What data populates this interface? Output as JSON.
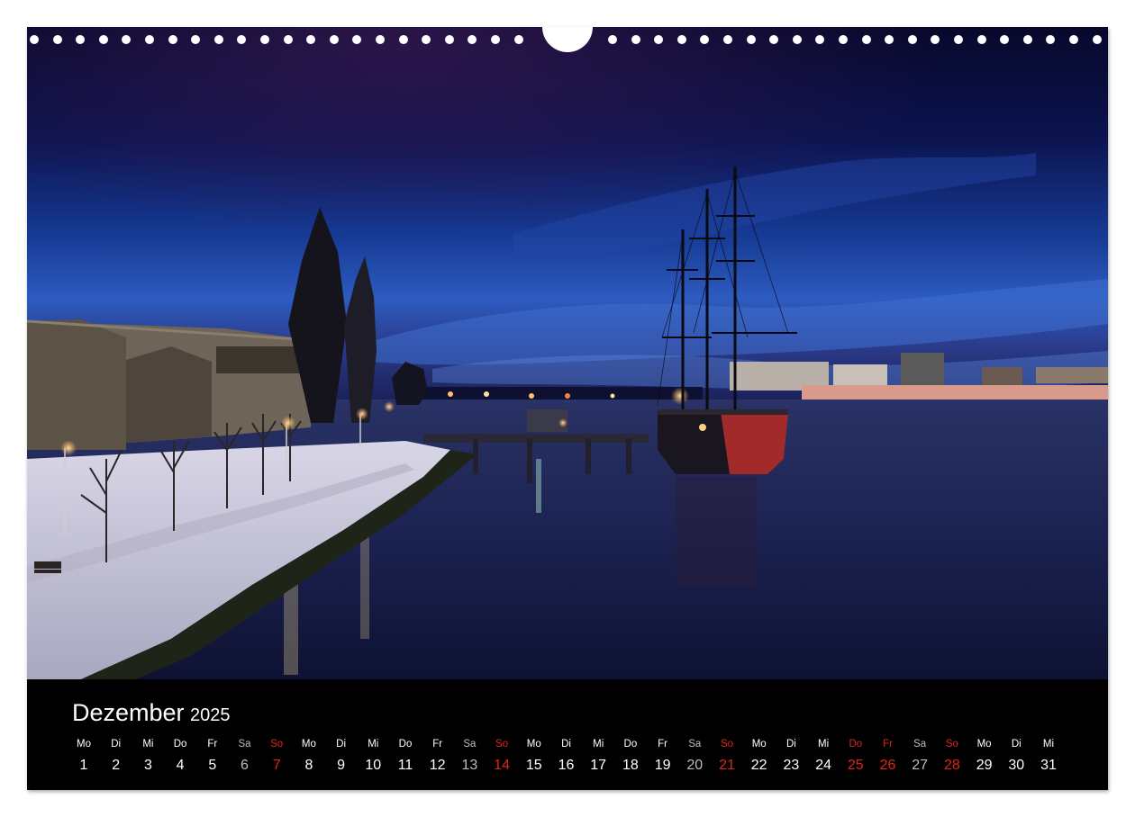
{
  "calendar": {
    "month": "Dezember",
    "year": "2025",
    "days": [
      {
        "wd": "Mo",
        "num": "1",
        "kind": "normal"
      },
      {
        "wd": "Di",
        "num": "2",
        "kind": "normal"
      },
      {
        "wd": "Mi",
        "num": "3",
        "kind": "normal"
      },
      {
        "wd": "Do",
        "num": "4",
        "kind": "normal"
      },
      {
        "wd": "Fr",
        "num": "5",
        "kind": "normal"
      },
      {
        "wd": "Sa",
        "num": "6",
        "kind": "sat"
      },
      {
        "wd": "So",
        "num": "7",
        "kind": "sun"
      },
      {
        "wd": "Mo",
        "num": "8",
        "kind": "normal"
      },
      {
        "wd": "Di",
        "num": "9",
        "kind": "normal"
      },
      {
        "wd": "Mi",
        "num": "10",
        "kind": "normal"
      },
      {
        "wd": "Do",
        "num": "11",
        "kind": "normal"
      },
      {
        "wd": "Fr",
        "num": "12",
        "kind": "normal"
      },
      {
        "wd": "Sa",
        "num": "13",
        "kind": "sat"
      },
      {
        "wd": "So",
        "num": "14",
        "kind": "sun"
      },
      {
        "wd": "Mo",
        "num": "15",
        "kind": "normal"
      },
      {
        "wd": "Di",
        "num": "16",
        "kind": "normal"
      },
      {
        "wd": "Mi",
        "num": "17",
        "kind": "normal"
      },
      {
        "wd": "Do",
        "num": "18",
        "kind": "normal"
      },
      {
        "wd": "Fr",
        "num": "19",
        "kind": "normal"
      },
      {
        "wd": "Sa",
        "num": "20",
        "kind": "sat"
      },
      {
        "wd": "So",
        "num": "21",
        "kind": "sun"
      },
      {
        "wd": "Mo",
        "num": "22",
        "kind": "normal"
      },
      {
        "wd": "Di",
        "num": "23",
        "kind": "normal"
      },
      {
        "wd": "Mi",
        "num": "24",
        "kind": "normal"
      },
      {
        "wd": "Do",
        "num": "25",
        "kind": "hol"
      },
      {
        "wd": "Fr",
        "num": "26",
        "kind": "hol"
      },
      {
        "wd": "Sa",
        "num": "27",
        "kind": "sat"
      },
      {
        "wd": "So",
        "num": "28",
        "kind": "sun"
      },
      {
        "wd": "Mo",
        "num": "29",
        "kind": "normal"
      },
      {
        "wd": "Di",
        "num": "30",
        "kind": "normal"
      },
      {
        "wd": "Mi",
        "num": "31",
        "kind": "normal"
      }
    ]
  },
  "colors": {
    "holiday_red": "#e2231a",
    "saturday_gray": "#bdbdbd",
    "band_black": "#000000"
  }
}
